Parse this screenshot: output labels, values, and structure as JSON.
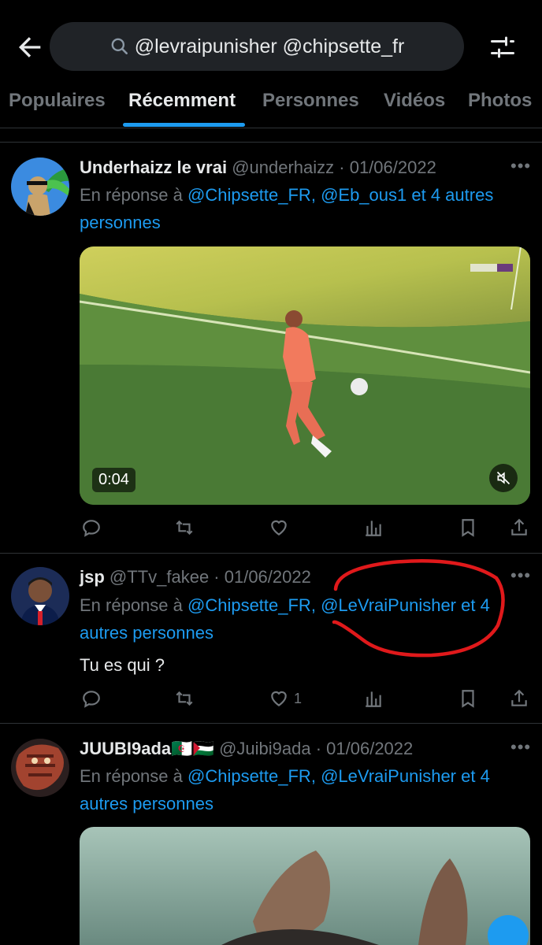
{
  "search": {
    "query": "@levraipunisher @chipsette_fr"
  },
  "tabs": [
    {
      "label": "Populaires"
    },
    {
      "label": "Récemment"
    },
    {
      "label": "Personnes"
    },
    {
      "label": "Vidéos"
    },
    {
      "label": "Photos"
    }
  ],
  "active_tab": "Récemment",
  "tweets": [
    {
      "name": "Underhaizz le vrai",
      "handle_date": "@underhaizz · 01/06/2022",
      "reply_prefix": "En réponse à ",
      "mention1": "@Chipsette_FR,",
      "mention2": "@Eb_ous1",
      "reply_suffix": " et 4 autres personnes",
      "video_duration": "0:04"
    },
    {
      "name": "jsp",
      "handle_date": "@TTv_fakee · 01/06/2022",
      "reply_prefix": "En réponse à ",
      "mention1": "@Chipsette_FR,",
      "mention2": "@LeVraiPunisher",
      "reply_suffix": " et 4 autres personnes",
      "text": "Tu es qui ?",
      "like_count": "1"
    },
    {
      "name": "JUUBI9ada🇩🇿🇵🇸",
      "handle_date": "@Juibi9ada · 01/06/2022",
      "reply_prefix": "En réponse à ",
      "mention1": "@Chipsette_FR,",
      "mention2": "@LeVraiPunisher",
      "reply_suffix": " et 4 autres personnes"
    }
  ],
  "colors": {
    "accent": "#1d9bf0",
    "annotation": "#e0191b",
    "background": "#000000"
  }
}
